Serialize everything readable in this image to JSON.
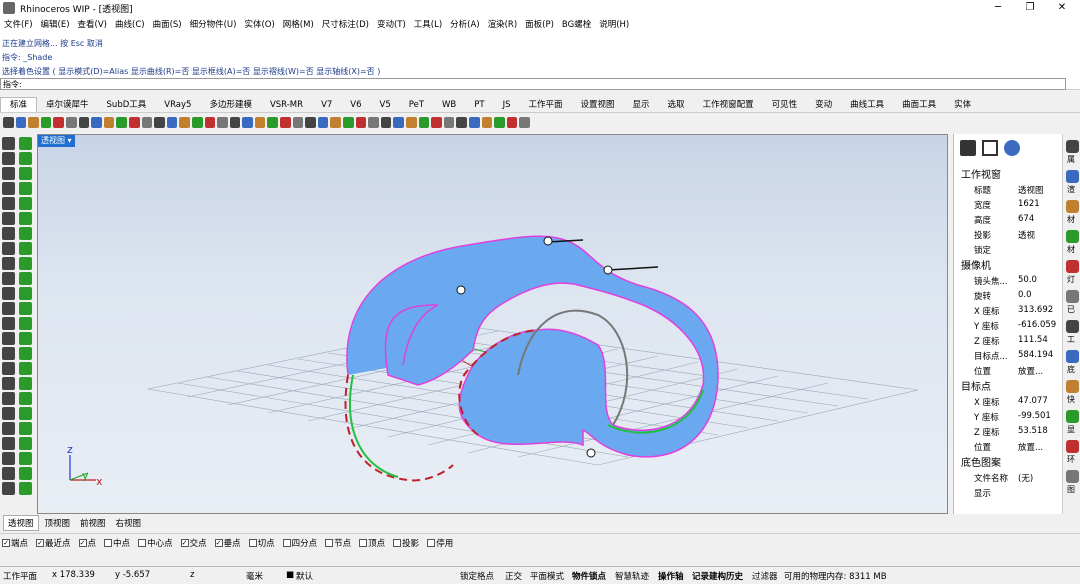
{
  "window": {
    "title": "Rhinoceros WIP - [透视图]",
    "controls": [
      "─",
      "❐",
      "✕"
    ]
  },
  "menu": [
    "文件(F)",
    "编辑(E)",
    "查看(V)",
    "曲线(C)",
    "曲面(S)",
    "细分物件(U)",
    "实体(O)",
    "网格(M)",
    "尺寸标注(D)",
    "变动(T)",
    "工具(L)",
    "分析(A)",
    "渲染(R)",
    "面板(P)",
    "BG螺栓",
    "说明(H)"
  ],
  "command": {
    "line1": "正在建立网格... 按 Esc 取消",
    "line2": "指令: _Shade",
    "line3": "选择着色设置 ( 显示模式(D)=Alias  显示曲线(R)=否  显示框线(A)=否  显示褶线(W)=否  显示轴线(X)=否 )",
    "prompt": "指令:"
  },
  "tabs": [
    "标准",
    "卓尔谟犀牛",
    "SubD工具",
    "VRay5",
    "多边形建模",
    "VSR-MR",
    "V7",
    "V6",
    "V5",
    "PeT",
    "WB",
    "PT",
    "JS",
    "工作平面",
    "设置视图",
    "显示",
    "选取",
    "工作视窗配置",
    "可见性",
    "变动",
    "曲线工具",
    "曲面工具",
    "实体"
  ],
  "viewport": {
    "title": "透视图",
    "axis": {
      "z": "z",
      "y": "y",
      "x": "x"
    }
  },
  "viewport_tabs": [
    "透视图",
    "顶视图",
    "前视图",
    "右视图"
  ],
  "osnaps": [
    {
      "label": "端点",
      "checked": true
    },
    {
      "label": "最近点",
      "checked": true
    },
    {
      "label": "点",
      "checked": true
    },
    {
      "label": "中点",
      "checked": false
    },
    {
      "label": "中心点",
      "checked": false
    },
    {
      "label": "交点",
      "checked": true
    },
    {
      "label": "垂点",
      "checked": true
    },
    {
      "label": "切点",
      "checked": false
    },
    {
      "label": "四分点",
      "checked": false
    },
    {
      "label": "节点",
      "checked": false
    },
    {
      "label": "顶点",
      "checked": false
    },
    {
      "label": "投影",
      "checked": false
    },
    {
      "label": "停用",
      "checked": false
    }
  ],
  "status": {
    "plane": "工作平面",
    "x": "x 178.339",
    "y": "y -5.657",
    "z": "z",
    "unit": "毫米",
    "layer": "默认",
    "grid_snap": "锁定格点",
    "ortho": "正交",
    "planar": "平面模式",
    "osnap": "物件锁点",
    "smart": "智慧轨迹",
    "gumball": "操作轴",
    "history": "记录建构历史",
    "filter": "过滤器",
    "memory": "可用的物理内存: 8311 MB"
  },
  "panel": {
    "section1": "工作视窗",
    "rows1": [
      [
        "标题",
        "透视图"
      ],
      [
        "宽度",
        "1621"
      ],
      [
        "高度",
        "674"
      ],
      [
        "投影",
        "透视"
      ],
      [
        "锁定",
        ""
      ]
    ],
    "section2": "摄像机",
    "rows2": [
      [
        "镜头焦...",
        "50.0"
      ],
      [
        "旋转",
        "0.0"
      ],
      [
        "X 座标",
        "313.692"
      ],
      [
        "Y 座标",
        "-616.059"
      ],
      [
        "Z 座标",
        "111.54"
      ],
      [
        "目标点...",
        "584.194"
      ],
      [
        "位置",
        "放置..."
      ]
    ],
    "section3": "目标点",
    "rows3": [
      [
        "X 座标",
        "47.077"
      ],
      [
        "Y 座标",
        "-99.501"
      ],
      [
        "Z 座标",
        "53.518"
      ],
      [
        "位置",
        "放置..."
      ]
    ],
    "section4": "底色图案",
    "rows4": [
      [
        "文件名称",
        "(无)"
      ],
      [
        "显示",
        ""
      ]
    ],
    "right_tabs": [
      "属",
      "渲",
      "材",
      "材",
      "灯",
      "已",
      "工",
      "底",
      "快",
      "显",
      "环",
      "图"
    ]
  }
}
